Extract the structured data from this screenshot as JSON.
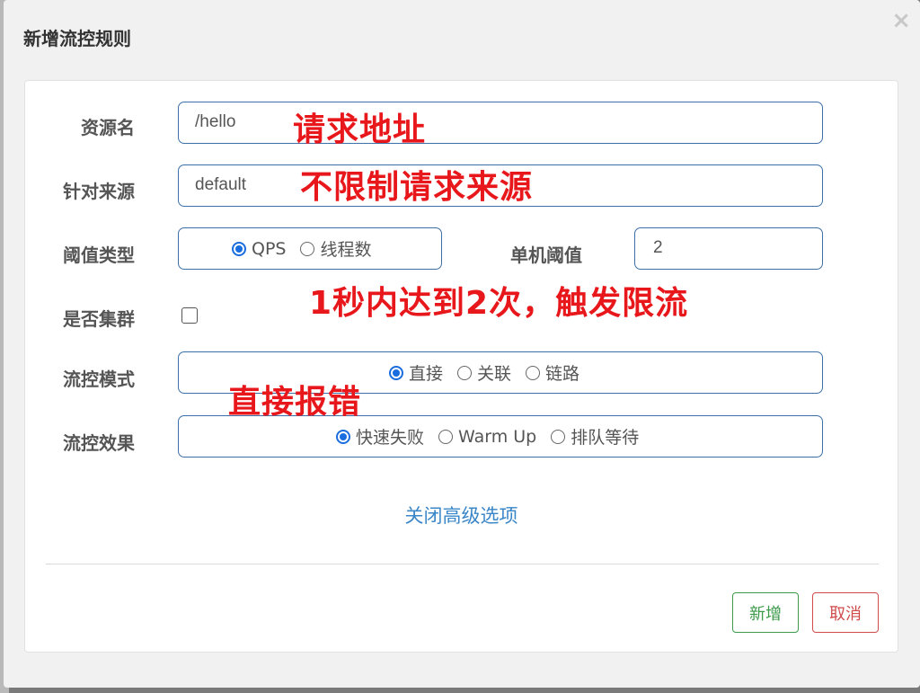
{
  "dialog": {
    "title": "新增流控规则",
    "close_glyph": "×"
  },
  "form": {
    "resource": {
      "label": "资源名",
      "value": "/hello"
    },
    "limit_app": {
      "label": "针对来源",
      "value": "default"
    },
    "grade": {
      "label": "阈值类型",
      "options": [
        {
          "label": "QPS",
          "checked": true
        },
        {
          "label": "线程数",
          "checked": false
        }
      ]
    },
    "threshold": {
      "label": "单机阈值",
      "value": "2"
    },
    "cluster": {
      "label": "是否集群",
      "checked": false
    },
    "strategy": {
      "label": "流控模式",
      "options": [
        {
          "label": "直接",
          "checked": true
        },
        {
          "label": "关联",
          "checked": false
        },
        {
          "label": "链路",
          "checked": false
        }
      ]
    },
    "control_behavior": {
      "label": "流控效果",
      "options": [
        {
          "label": "快速失败",
          "checked": true
        },
        {
          "label": "Warm Up",
          "checked": false
        },
        {
          "label": "排队等待",
          "checked": false
        }
      ]
    },
    "advanced_link": "关闭高级选项"
  },
  "annotations": {
    "resource_note": "请求地址",
    "origin_note": "不限制请求来源",
    "threshold_note": "1秒内达到2次，触发限流",
    "strategy_note": "直接报错"
  },
  "footer": {
    "add_label": "新增",
    "cancel_label": "取消"
  },
  "colors": {
    "primary_radio": "#1a6dde",
    "annotation": "#e8171b",
    "link": "#3a86c8",
    "success": "#3c9a4a",
    "danger": "#d14b4b"
  }
}
